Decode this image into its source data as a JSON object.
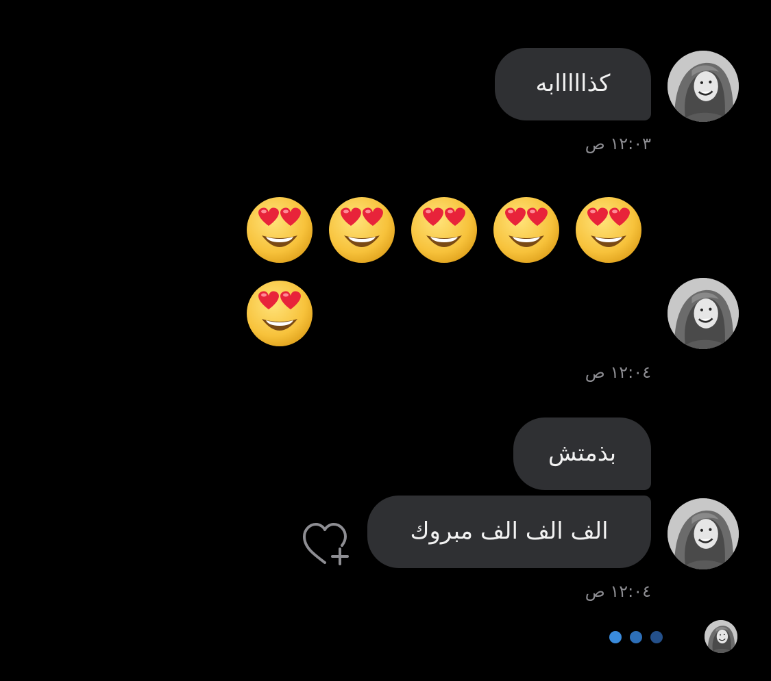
{
  "messages": [
    {
      "text": "كذااااابه",
      "time": "١٢:٠٣ ص"
    },
    {
      "emoji_count": 6,
      "time": "١٢:٠٤ ص"
    },
    {
      "text": "بذمتش"
    },
    {
      "text": "الف الف الف مبروك",
      "time": "١٢:٠٤ ص"
    }
  ],
  "icons": {
    "avatar": "avatar-photo",
    "emoji": "heart-eyes-emoji",
    "reaction": "heart-plus-icon"
  },
  "typing_indicator": {
    "dot_colors": [
      "#3a8bdc",
      "#2d6fb8",
      "#24508a"
    ]
  },
  "colors": {
    "background": "#000000",
    "bubble": "#2f3033",
    "timestamp": "#8e8e93"
  }
}
